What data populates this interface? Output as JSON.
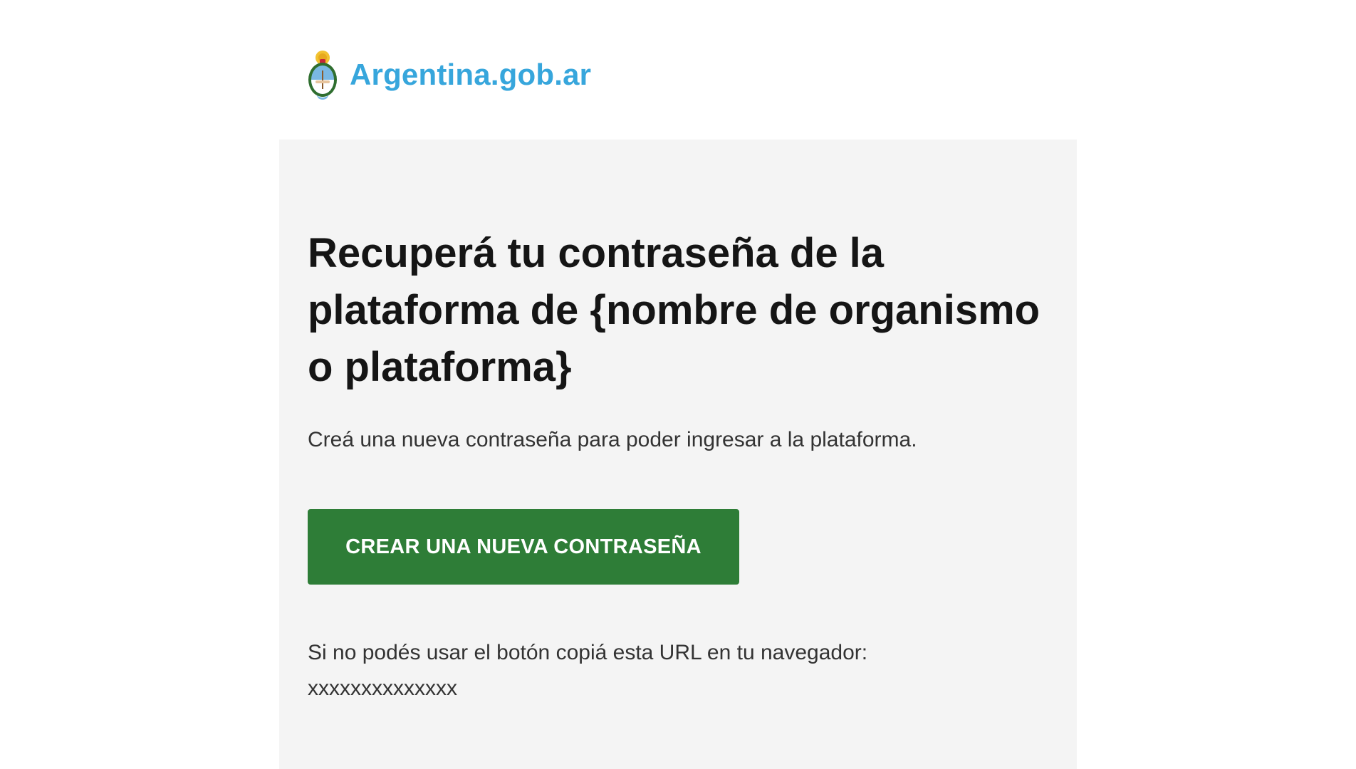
{
  "brand": {
    "logo_text": "Argentina.gob.ar",
    "logo_color": "#37a6dc"
  },
  "card": {
    "title": "Recuperá tu contraseña de la plataforma de {nombre de organismo o plataforma}",
    "subtitle": "Creá una nueva contraseña para poder ingresar a la plataforma.",
    "button_label": "CREAR UNA NUEVA CONTRASEÑA",
    "button_color": "#2e7d37",
    "fallback_text": "Si no podés usar el botón copiá esta URL en tu navegador:",
    "fallback_url": "xxxxxxxxxxxxxx"
  }
}
